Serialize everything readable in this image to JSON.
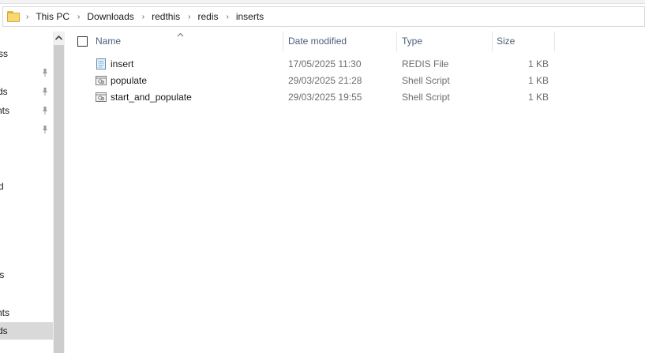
{
  "breadcrumb": [
    "This PC",
    "Downloads",
    "redthis",
    "redis",
    "inserts"
  ],
  "nav": {
    "items": [
      {
        "label": "ss",
        "pinned": false,
        "selected": false
      },
      {
        "label": "",
        "pinned": true,
        "selected": false
      },
      {
        "label": "ds",
        "pinned": true,
        "selected": false
      },
      {
        "label": "nts",
        "pinned": true,
        "selected": false
      },
      {
        "label": "",
        "pinned": true,
        "selected": false
      },
      {
        "label": "d",
        "pinned": false,
        "selected": false
      },
      {
        "label": "ts",
        "pinned": false,
        "selected": false
      },
      {
        "label": "nts",
        "pinned": false,
        "selected": false
      },
      {
        "label": "ds",
        "pinned": false,
        "selected": true
      }
    ]
  },
  "columns": {
    "name": "Name",
    "date": "Date modified",
    "type": "Type",
    "size": "Size"
  },
  "files": [
    {
      "name": "insert",
      "date": "17/05/2025 11:30",
      "type": "REDIS File",
      "size": "1 KB",
      "icon": "text-file-icon"
    },
    {
      "name": "populate",
      "date": "29/03/2025 21:28",
      "type": "Shell Script",
      "size": "1 KB",
      "icon": "script-file-icon"
    },
    {
      "name": "start_and_populate",
      "date": "29/03/2025 19:55",
      "type": "Shell Script",
      "size": "1 KB",
      "icon": "script-file-icon"
    }
  ],
  "colors": {
    "header_text": "#4c607a",
    "muted_text": "#6d6d6d",
    "selected_nav": "#d9d9d9"
  }
}
